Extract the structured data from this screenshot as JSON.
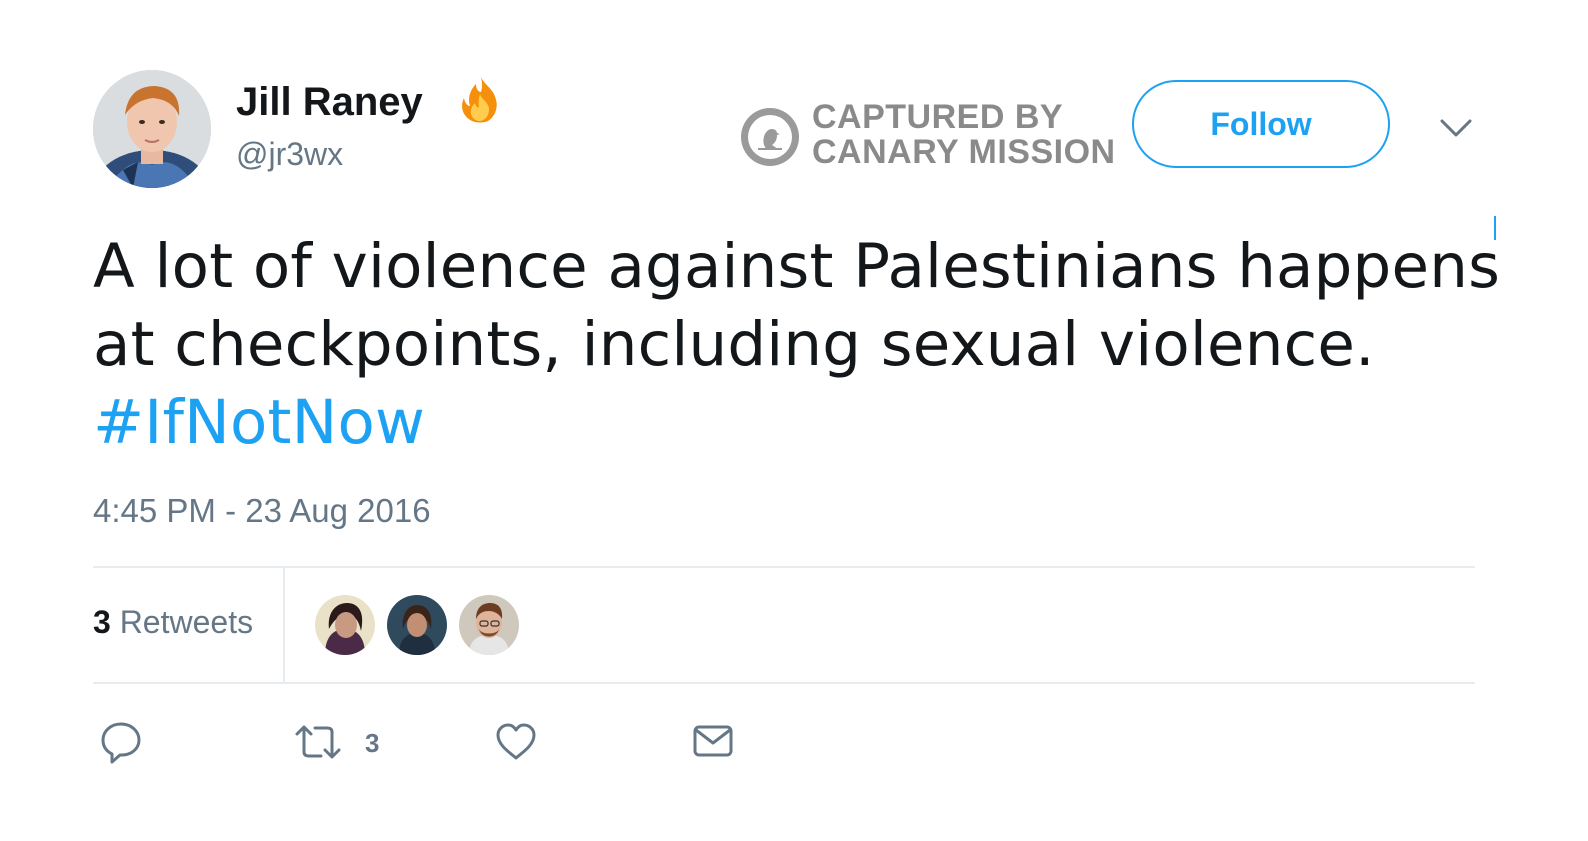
{
  "author": {
    "display_name": "Jill Raney",
    "screen_name": "@jr3wx",
    "badge_icon": "fire-icon"
  },
  "watermark": {
    "line1": "CAPTURED BY",
    "line2": "CANARY MISSION",
    "icon": "canary-bird-icon"
  },
  "follow_button": {
    "label": "Follow"
  },
  "tweet": {
    "text_line1": "A lot of violence against Palestinians happens",
    "text_line2": "at checkpoints, including sexual violence.",
    "hashtag": "#IfNotNow",
    "timestamp": "4:45 PM - 23 Aug 2016"
  },
  "stats": {
    "retweet_count": "3",
    "retweet_label": "Retweets"
  },
  "actions": {
    "reply_icon": "reply-icon",
    "retweet_icon": "retweet-icon",
    "retweet_count": "3",
    "like_icon": "heart-icon",
    "dm_icon": "envelope-icon"
  },
  "colors": {
    "accent": "#1da1f2",
    "muted_text": "#657786",
    "primary_text": "#14171a",
    "divider": "#e6ecf0"
  }
}
